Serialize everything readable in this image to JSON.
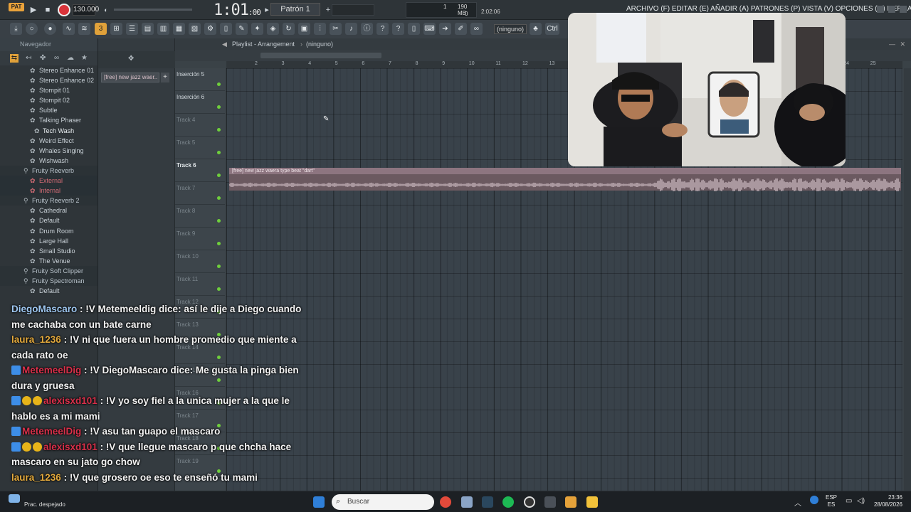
{
  "topbar": {
    "pat_label": "PAT",
    "tempo": "130.000",
    "time_main": "1:01",
    "time_sub": ":00",
    "pattern": "Patrón 1",
    "cpu_value": "1",
    "ram": "190 MB",
    "polyphony": "0",
    "elapsed": "2:02:06",
    "menu": "ARCHIVO (F)  EDITAR (E)  AÑADIR (A)  PATRONES (P)  VISTA (V)  OPCIONES (O)  HERRAMIENTAS (T)  AYUDA"
  },
  "toolbar": {
    "snap": "(ninguno)",
    "ctrl": "Ctrl"
  },
  "browser": {
    "title": "Navegador",
    "items": [
      {
        "label": "Stereo Enhance 01",
        "kind": "preset"
      },
      {
        "label": "Stereo Enhance 02",
        "kind": "preset"
      },
      {
        "label": "Stompit 01",
        "kind": "preset"
      },
      {
        "label": "Stompit 02",
        "kind": "preset"
      },
      {
        "label": "Subtle",
        "kind": "preset"
      },
      {
        "label": "Talking Phaser",
        "kind": "preset"
      },
      {
        "label": "Tech Wash",
        "kind": "selected"
      },
      {
        "label": "Weird Effect",
        "kind": "preset"
      },
      {
        "label": "Whales Singing",
        "kind": "preset"
      },
      {
        "label": "Wishwash",
        "kind": "preset"
      },
      {
        "label": "Fruity Reeverb",
        "kind": "folder"
      },
      {
        "label": "External",
        "kind": "red"
      },
      {
        "label": "Internal",
        "kind": "red"
      },
      {
        "label": "Fruity Reeverb 2",
        "kind": "folder"
      },
      {
        "label": "Cathedral",
        "kind": "preset"
      },
      {
        "label": "Default",
        "kind": "preset"
      },
      {
        "label": "Drum Room",
        "kind": "preset"
      },
      {
        "label": "Large Hall",
        "kind": "preset"
      },
      {
        "label": "Small Studio",
        "kind": "preset"
      },
      {
        "label": "The Venue",
        "kind": "preset"
      },
      {
        "label": "Fruity Soft Clipper",
        "kind": "folder"
      },
      {
        "label": "Fruity Spectroman",
        "kind": "folder"
      },
      {
        "label": "Default",
        "kind": "preset"
      }
    ]
  },
  "channels": {
    "clip_tag": "[free] new jazz  waer.."
  },
  "playlist": {
    "title": "Playlist - Arrangement",
    "pattern": "(ninguno)",
    "ruler": [
      "2",
      "3",
      "4",
      "5",
      "6",
      "7",
      "8",
      "9",
      "10",
      "11",
      "12",
      "13",
      "14",
      "15",
      "16",
      "17",
      "18",
      "19",
      "20",
      "21",
      "22",
      "23",
      "24",
      "25"
    ],
    "tracks": [
      {
        "label": "Inserción 5",
        "style": "ins"
      },
      {
        "label": "Inserción 6",
        "style": "ins"
      },
      {
        "label": "Track 4",
        "style": "dim"
      },
      {
        "label": "Track 5",
        "style": "dim"
      },
      {
        "label": "Track 6",
        "style": "bold"
      },
      {
        "label": "Track 7",
        "style": "dim"
      },
      {
        "label": "Track 8",
        "style": "dim"
      },
      {
        "label": "Track 9",
        "style": "dim"
      },
      {
        "label": "Track 10",
        "style": "dim"
      },
      {
        "label": "Track 11",
        "style": "dim"
      },
      {
        "label": "Track 12",
        "style": "dim"
      },
      {
        "label": "Track 13",
        "style": "dim"
      },
      {
        "label": "Track 14",
        "style": "dim"
      },
      {
        "label": "Track 15",
        "style": "dim"
      },
      {
        "label": "Track 16",
        "style": "dim"
      },
      {
        "label": "Track 17",
        "style": "dim"
      },
      {
        "label": "Track 18",
        "style": "dim"
      },
      {
        "label": "Track 19",
        "style": "dim"
      }
    ],
    "clip_name": "[free] new jazz  waera type beat  \"dart\""
  },
  "chat": [
    {
      "user": "DiegoMascaro",
      "color": "#9fc8f2",
      "badges": [],
      "text": "!V Metemeeldig dice: así le dije a Diego cuando me cachaba con un bate carne"
    },
    {
      "user": "laura_1236",
      "color": "#e3a93c",
      "badges": [],
      "text": "!V ni que fuera un hombre promedio que miente a cada rato oe"
    },
    {
      "user": "MetemeelDig",
      "color": "#d9304a",
      "badges": [
        "blue"
      ],
      "text": "!V DiegoMascaro dice: Me gusta la pinga bien dura y gruesa"
    },
    {
      "user": "alexisxd101",
      "color": "#d9304a",
      "badges": [
        "blue",
        "gold",
        "gold"
      ],
      "text": "!V yo soy fiel a la unica mujer a la que le hablo es a mi mami"
    },
    {
      "user": "MetemeelDig",
      "color": "#d9304a",
      "badges": [
        "blue"
      ],
      "text": "!V asu tan guapo el mascaro"
    },
    {
      "user": "alexisxd101",
      "color": "#d9304a",
      "badges": [
        "blue",
        "gold",
        "gold"
      ],
      "text": "!V que llegue mascaro p que chcha hace mascaro en su jato go chow"
    },
    {
      "user": "laura_1236",
      "color": "#e3a93c",
      "badges": [],
      "text": "!V que grosero oe eso te enseñó tu mami"
    }
  ],
  "taskbar": {
    "search_placeholder": "Buscar",
    "weather": "Prac. despejado",
    "lang_top": "ESP",
    "lang_bottom": "ES",
    "time": "23:36",
    "date": "28/08/2026"
  }
}
